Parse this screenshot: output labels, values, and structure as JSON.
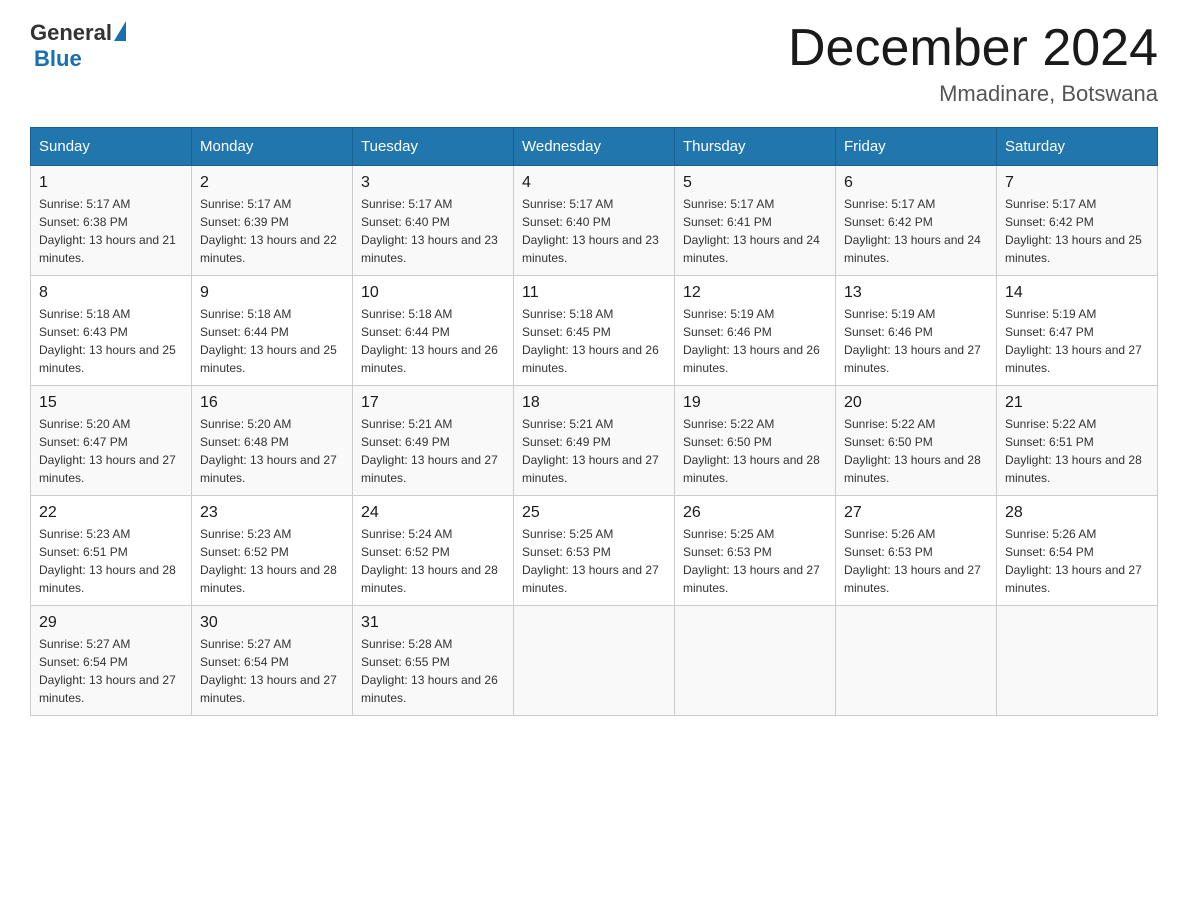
{
  "header": {
    "title": "December 2024",
    "location": "Mmadinare, Botswana",
    "logo_general": "General",
    "logo_blue": "Blue"
  },
  "weekdays": [
    "Sunday",
    "Monday",
    "Tuesday",
    "Wednesday",
    "Thursday",
    "Friday",
    "Saturday"
  ],
  "weeks": [
    [
      {
        "day": "1",
        "sunrise": "5:17 AM",
        "sunset": "6:38 PM",
        "daylight": "13 hours and 21 minutes."
      },
      {
        "day": "2",
        "sunrise": "5:17 AM",
        "sunset": "6:39 PM",
        "daylight": "13 hours and 22 minutes."
      },
      {
        "day": "3",
        "sunrise": "5:17 AM",
        "sunset": "6:40 PM",
        "daylight": "13 hours and 23 minutes."
      },
      {
        "day": "4",
        "sunrise": "5:17 AM",
        "sunset": "6:40 PM",
        "daylight": "13 hours and 23 minutes."
      },
      {
        "day": "5",
        "sunrise": "5:17 AM",
        "sunset": "6:41 PM",
        "daylight": "13 hours and 24 minutes."
      },
      {
        "day": "6",
        "sunrise": "5:17 AM",
        "sunset": "6:42 PM",
        "daylight": "13 hours and 24 minutes."
      },
      {
        "day": "7",
        "sunrise": "5:17 AM",
        "sunset": "6:42 PM",
        "daylight": "13 hours and 25 minutes."
      }
    ],
    [
      {
        "day": "8",
        "sunrise": "5:18 AM",
        "sunset": "6:43 PM",
        "daylight": "13 hours and 25 minutes."
      },
      {
        "day": "9",
        "sunrise": "5:18 AM",
        "sunset": "6:44 PM",
        "daylight": "13 hours and 25 minutes."
      },
      {
        "day": "10",
        "sunrise": "5:18 AM",
        "sunset": "6:44 PM",
        "daylight": "13 hours and 26 minutes."
      },
      {
        "day": "11",
        "sunrise": "5:18 AM",
        "sunset": "6:45 PM",
        "daylight": "13 hours and 26 minutes."
      },
      {
        "day": "12",
        "sunrise": "5:19 AM",
        "sunset": "6:46 PM",
        "daylight": "13 hours and 26 minutes."
      },
      {
        "day": "13",
        "sunrise": "5:19 AM",
        "sunset": "6:46 PM",
        "daylight": "13 hours and 27 minutes."
      },
      {
        "day": "14",
        "sunrise": "5:19 AM",
        "sunset": "6:47 PM",
        "daylight": "13 hours and 27 minutes."
      }
    ],
    [
      {
        "day": "15",
        "sunrise": "5:20 AM",
        "sunset": "6:47 PM",
        "daylight": "13 hours and 27 minutes."
      },
      {
        "day": "16",
        "sunrise": "5:20 AM",
        "sunset": "6:48 PM",
        "daylight": "13 hours and 27 minutes."
      },
      {
        "day": "17",
        "sunrise": "5:21 AM",
        "sunset": "6:49 PM",
        "daylight": "13 hours and 27 minutes."
      },
      {
        "day": "18",
        "sunrise": "5:21 AM",
        "sunset": "6:49 PM",
        "daylight": "13 hours and 27 minutes."
      },
      {
        "day": "19",
        "sunrise": "5:22 AM",
        "sunset": "6:50 PM",
        "daylight": "13 hours and 28 minutes."
      },
      {
        "day": "20",
        "sunrise": "5:22 AM",
        "sunset": "6:50 PM",
        "daylight": "13 hours and 28 minutes."
      },
      {
        "day": "21",
        "sunrise": "5:22 AM",
        "sunset": "6:51 PM",
        "daylight": "13 hours and 28 minutes."
      }
    ],
    [
      {
        "day": "22",
        "sunrise": "5:23 AM",
        "sunset": "6:51 PM",
        "daylight": "13 hours and 28 minutes."
      },
      {
        "day": "23",
        "sunrise": "5:23 AM",
        "sunset": "6:52 PM",
        "daylight": "13 hours and 28 minutes."
      },
      {
        "day": "24",
        "sunrise": "5:24 AM",
        "sunset": "6:52 PM",
        "daylight": "13 hours and 28 minutes."
      },
      {
        "day": "25",
        "sunrise": "5:25 AM",
        "sunset": "6:53 PM",
        "daylight": "13 hours and 27 minutes."
      },
      {
        "day": "26",
        "sunrise": "5:25 AM",
        "sunset": "6:53 PM",
        "daylight": "13 hours and 27 minutes."
      },
      {
        "day": "27",
        "sunrise": "5:26 AM",
        "sunset": "6:53 PM",
        "daylight": "13 hours and 27 minutes."
      },
      {
        "day": "28",
        "sunrise": "5:26 AM",
        "sunset": "6:54 PM",
        "daylight": "13 hours and 27 minutes."
      }
    ],
    [
      {
        "day": "29",
        "sunrise": "5:27 AM",
        "sunset": "6:54 PM",
        "daylight": "13 hours and 27 minutes."
      },
      {
        "day": "30",
        "sunrise": "5:27 AM",
        "sunset": "6:54 PM",
        "daylight": "13 hours and 27 minutes."
      },
      {
        "day": "31",
        "sunrise": "5:28 AM",
        "sunset": "6:55 PM",
        "daylight": "13 hours and 26 minutes."
      },
      null,
      null,
      null,
      null
    ]
  ]
}
